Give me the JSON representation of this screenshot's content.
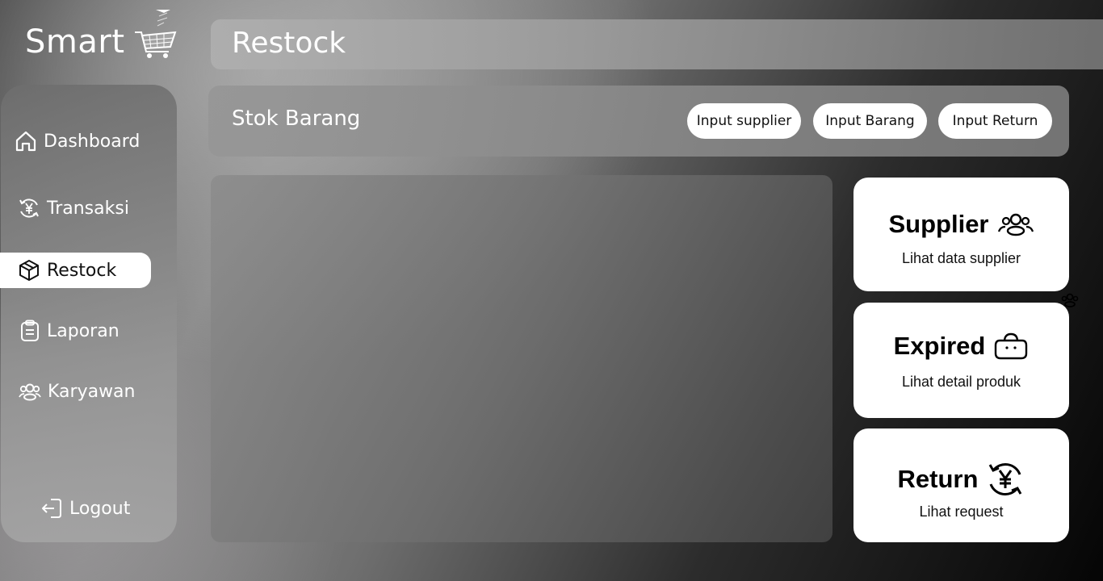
{
  "brand": {
    "name": "Smart",
    "icon": "shopping-cart-icon"
  },
  "header": {
    "title": "Restock"
  },
  "sidebar": {
    "items": [
      {
        "label": "Dashboard",
        "icon": "home-icon"
      },
      {
        "label": "Transaksi",
        "icon": "yen-exchange-icon"
      },
      {
        "label": "Restock",
        "icon": "package-icon",
        "active": true
      },
      {
        "label": "Laporan",
        "icon": "clipboard-icon"
      },
      {
        "label": "Karyawan",
        "icon": "users-icon"
      }
    ],
    "logout": {
      "label": "Logout",
      "icon": "logout-icon"
    }
  },
  "toolbar": {
    "title": "Stok Barang",
    "buttons": [
      "Input supplier",
      "Input Barang",
      "Input Return"
    ]
  },
  "cards": [
    {
      "title": "Supplier",
      "subtitle": "Lihat data supplier",
      "icon": "users-icon"
    },
    {
      "title": "Expired",
      "subtitle": "Lihat detail produk",
      "icon": "bag-icon"
    },
    {
      "title": "Return",
      "subtitle": "Lihat request",
      "icon": "yen-exchange-icon"
    }
  ],
  "colors": {
    "accent": "#ffffff",
    "text_dark": "#111111"
  }
}
